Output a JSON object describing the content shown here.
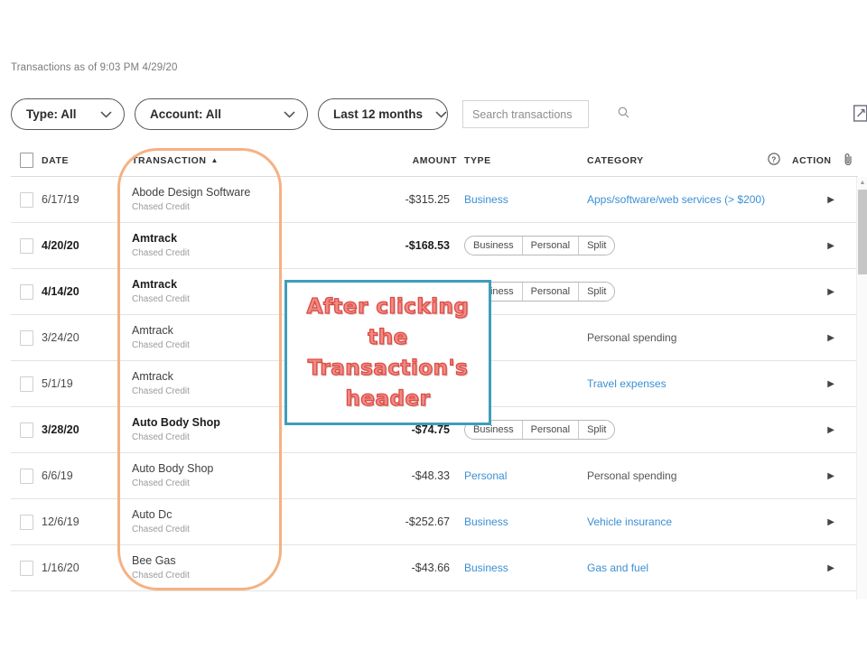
{
  "meta": {
    "status_line": "Transactions as of 9:03 PM 4/29/20"
  },
  "filters": {
    "type": {
      "label": "Type: All",
      "icon": "chevron-down-icon"
    },
    "account": {
      "label": "Account: All",
      "icon": "chevron-down-icon"
    },
    "range": {
      "label": "Last 12 months",
      "icon": "chevron-down-icon"
    },
    "search": {
      "placeholder": "Search transactions",
      "value": "",
      "icon": "search-icon"
    },
    "edit_icon": "edit-square-icon"
  },
  "table": {
    "headers": {
      "select_all": "",
      "date": "DATE",
      "transaction": "TRANSACTION",
      "sort_caret": "▲",
      "amount": "AMOUNT",
      "type": "TYPE",
      "category": "CATEGORY",
      "help_icon": "?",
      "action": "ACTION",
      "attachment_icon": "paperclip-icon"
    },
    "segmented_options": [
      "Business",
      "Personal",
      "Split"
    ],
    "rows": [
      {
        "date": "6/17/19",
        "name": "Abode Design Software",
        "account": "Chased Credit",
        "amount": "-$315.25",
        "bold": false,
        "type_kind": "link",
        "type_label": "Business",
        "category": "Apps/software/web services (> $200)",
        "category_kind": "link"
      },
      {
        "date": "4/20/20",
        "name": "Amtrack",
        "account": "Chased Credit",
        "amount": "-$168.53",
        "bold": true,
        "type_kind": "segmented",
        "type_label": "",
        "category": "",
        "category_kind": "none"
      },
      {
        "date": "4/14/20",
        "name": "Amtrack",
        "account": "Chased Credit",
        "amount": "",
        "bold": true,
        "type_kind": "segmented",
        "type_label": "",
        "category": "",
        "category_kind": "none"
      },
      {
        "date": "3/24/20",
        "name": "Amtrack",
        "account": "Chased Credit",
        "amount": "",
        "bold": false,
        "type_kind": "none",
        "type_label": "",
        "category": "Personal spending",
        "category_kind": "plain"
      },
      {
        "date": "5/1/19",
        "name": "Amtrack",
        "account": "Chased Credit",
        "amount": "",
        "bold": false,
        "type_kind": "none",
        "type_label": "",
        "category": "Travel expenses",
        "category_kind": "link"
      },
      {
        "date": "3/28/20",
        "name": "Auto Body Shop",
        "account": "Chased Credit",
        "amount": "-$74.75",
        "bold": true,
        "type_kind": "segmented",
        "type_label": "",
        "category": "",
        "category_kind": "none"
      },
      {
        "date": "6/6/19",
        "name": "Auto Body Shop",
        "account": "Chased Credit",
        "amount": "-$48.33",
        "bold": false,
        "type_kind": "link",
        "type_label": "Personal",
        "category": "Personal spending",
        "category_kind": "plain"
      },
      {
        "date": "12/6/19",
        "name": "Auto Dc",
        "account": "Chased Credit",
        "amount": "-$252.67",
        "bold": false,
        "type_kind": "link",
        "type_label": "Business",
        "category": "Vehicle insurance",
        "category_kind": "link"
      },
      {
        "date": "1/16/20",
        "name": "Bee Gas",
        "account": "Chased Credit",
        "amount": "-$43.66",
        "bold": false,
        "type_kind": "link",
        "type_label": "Business",
        "category": "Gas and fuel",
        "category_kind": "link"
      }
    ]
  },
  "annotations": {
    "callout_text": "After clicking the Transaction's header",
    "highlight_color": "#f5b183",
    "callout_border_color": "#3f9dba",
    "callout_text_color": "#f08a85"
  }
}
